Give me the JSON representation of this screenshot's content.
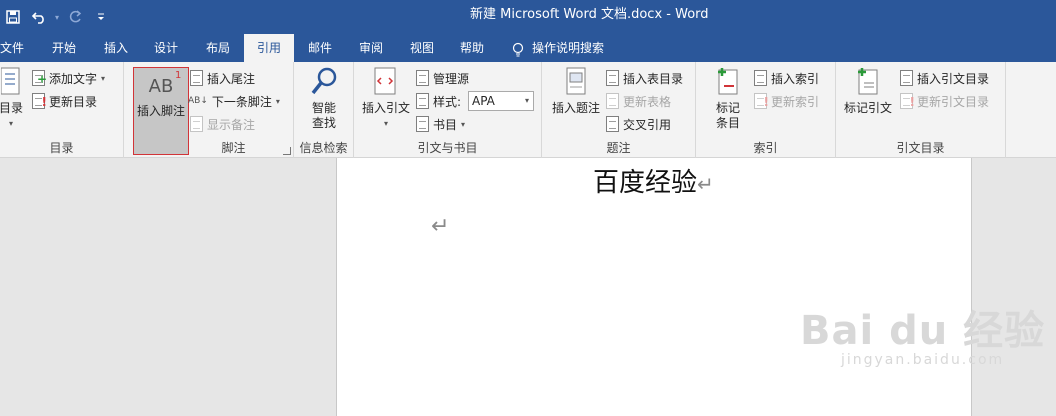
{
  "titlebar": {
    "title": "新建 Microsoft Word 文档.docx  -  Word",
    "qat": [
      "save-icon",
      "undo-icon",
      "redo-icon",
      "customize-icon"
    ]
  },
  "tabs": {
    "items": [
      "文件",
      "开始",
      "插入",
      "设计",
      "布局",
      "引用",
      "邮件",
      "审阅",
      "视图",
      "帮助"
    ],
    "active": "引用",
    "tell_me": "操作说明搜索"
  },
  "ribbon": {
    "toc": {
      "big_label": "目录",
      "add_text": "添加文字",
      "update": "更新目录",
      "group": "目录"
    },
    "footnotes": {
      "insert_footnote_icon": "AB",
      "insert_footnote_sup": "1",
      "insert_footnote": "插入脚注",
      "insert_endnote": "插入尾注",
      "next_footnote": "下一条脚注",
      "show_notes": "显示备注",
      "group": "脚注"
    },
    "research": {
      "smart_lookup_1": "智能",
      "smart_lookup_2": "查找",
      "group": "信息检索"
    },
    "citations": {
      "insert_citation": "插入引文",
      "manage_sources": "管理源",
      "style_label": "样式:",
      "style_value": "APA",
      "bibliography": "书目",
      "group": "引文与书目"
    },
    "captions": {
      "insert_caption": "插入题注",
      "insert_table_of_figures": "插入表目录",
      "update_table": "更新表格",
      "cross_reference": "交叉引用",
      "group": "题注"
    },
    "index": {
      "mark_entry_1": "标记",
      "mark_entry_2": "条目",
      "insert_index": "插入索引",
      "update_index": "更新索引",
      "group": "索引"
    },
    "authorities": {
      "mark_citation": "标记引文",
      "insert_toa": "插入引文目录",
      "update_toa": "更新引文目录",
      "group": "引文目录"
    }
  },
  "document": {
    "heading": "百度经验",
    "paragraph_mark": "↵"
  },
  "watermark": {
    "main": "Bai du 经验",
    "sub": "jingyan.baidu.com"
  },
  "colors": {
    "titlebar": "#2b579a",
    "ribbon": "#f3f3f3",
    "highlight_border": "#d13438"
  }
}
